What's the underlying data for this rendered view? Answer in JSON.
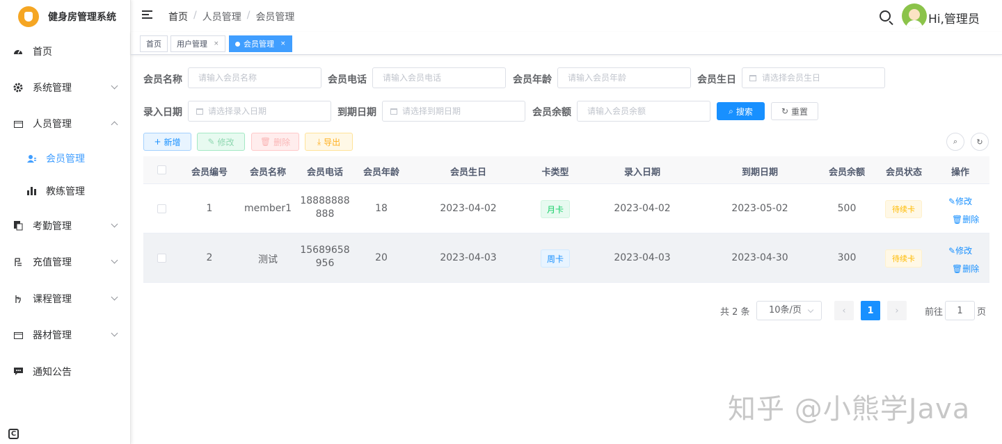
{
  "app": {
    "title": "健身房管理系统"
  },
  "sidebar": {
    "items": [
      {
        "label": "首页",
        "icon": "dashboard-icon"
      },
      {
        "label": "系统管理",
        "icon": "gear-icon"
      },
      {
        "label": "人员管理",
        "icon": "people-icon"
      },
      {
        "label": "会员管理",
        "icon": "user-icon"
      },
      {
        "label": "教练管理",
        "icon": "bar-chart-icon"
      },
      {
        "label": "考勤管理",
        "icon": "copy-icon"
      },
      {
        "label": "充值管理",
        "icon": "recharge-icon"
      },
      {
        "label": "课程管理",
        "icon": "hand-icon"
      },
      {
        "label": "器材管理",
        "icon": "equipment-icon"
      },
      {
        "label": "通知公告",
        "icon": "message-icon"
      }
    ],
    "bottom_icon": "C"
  },
  "header": {
    "breadcrumb": [
      "首页",
      "人员管理",
      "会员管理"
    ],
    "breadcrumb_sep": "/",
    "user_greeting": "Hi,管理员"
  },
  "tags": [
    {
      "label": "首页"
    },
    {
      "label": "用户管理",
      "close": "×"
    },
    {
      "label": "会员管理",
      "close": "×"
    }
  ],
  "search": {
    "name_label": "会员名称",
    "name_placeholder": "请输入会员名称",
    "phone_label": "会员电话",
    "phone_placeholder": "请输入会员电话",
    "age_label": "会员年龄",
    "age_placeholder": "请输入会员年龄",
    "birthday_label": "会员生日",
    "birthday_placeholder": "请选择会员生日",
    "entry_label": "录入日期",
    "entry_placeholder": "请选择录入日期",
    "expire_label": "到期日期",
    "expire_placeholder": "请选择到期日期",
    "balance_label": "会员余额",
    "balance_placeholder": "请输入会员余额",
    "search_btn": "搜索",
    "reset_btn": "重置"
  },
  "toolbar": {
    "add": "新增",
    "edit": "修改",
    "delete": "删除",
    "export": "导出"
  },
  "table": {
    "columns": [
      "会员编号",
      "会员名称",
      "会员电话",
      "会员年龄",
      "会员生日",
      "卡类型",
      "录入日期",
      "到期日期",
      "会员余额",
      "会员状态",
      "操作"
    ],
    "rows": [
      {
        "id": "1",
        "name": "member1",
        "phone1": "18888888",
        "phone2": "888",
        "age": "18",
        "birthday": "2023-04-02",
        "card": "月卡",
        "entry": "2023-04-02",
        "expire": "2023-05-02",
        "balance": "500",
        "status": "待续卡",
        "op_edit": "修改",
        "op_delete": "删除"
      },
      {
        "id": "2",
        "name": "测试",
        "phone1": "15689658",
        "phone2": "956",
        "age": "20",
        "birthday": "2023-04-03",
        "card": "周卡",
        "entry": "2023-04-03",
        "expire": "2023-04-30",
        "balance": "300",
        "status": "待续卡",
        "op_edit": "修改",
        "op_delete": "删除"
      }
    ]
  },
  "pagination": {
    "total": "共 2 条",
    "page_size": "10条/页",
    "current": "1",
    "goto_prefix": "前往",
    "goto_value": "1",
    "goto_suffix": "页"
  },
  "watermark": "知乎 @小熊学Java",
  "colors": {
    "primary": "#1890ff",
    "success": "#13ce66",
    "warning": "#ffba00",
    "danger": "#ff4949",
    "logo": "#f5a623"
  }
}
